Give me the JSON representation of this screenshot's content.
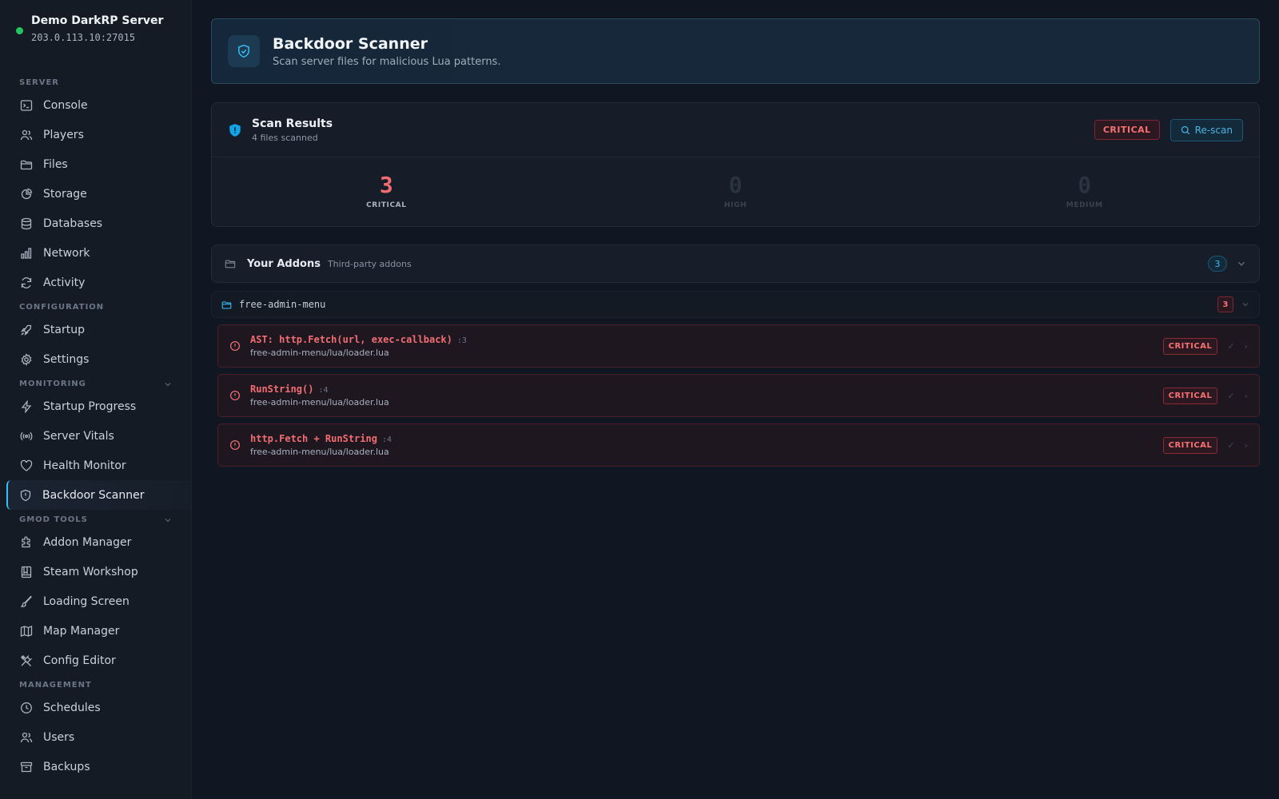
{
  "server": {
    "name": "Demo DarkRP Server",
    "address": "203.0.113.10:27015",
    "status_color": "#22c55e"
  },
  "sidebar": {
    "sections": {
      "server": "SERVER",
      "configuration": "CONFIGURATION",
      "monitoring": "MONITORING",
      "gmod_tools": "GMOD TOOLS",
      "management": "MANAGEMENT"
    },
    "items": {
      "console": "Console",
      "players": "Players",
      "files": "Files",
      "storage": "Storage",
      "databases": "Databases",
      "network": "Network",
      "activity": "Activity",
      "startup": "Startup",
      "settings": "Settings",
      "startup_progress": "Startup Progress",
      "server_vitals": "Server Vitals",
      "health_monitor": "Health Monitor",
      "backdoor_scanner": "Backdoor Scanner",
      "addon_manager": "Addon Manager",
      "steam_workshop": "Steam Workshop",
      "loading_screen": "Loading Screen",
      "map_manager": "Map Manager",
      "config_editor": "Config Editor",
      "schedules": "Schedules",
      "users": "Users",
      "backups": "Backups"
    },
    "active": "Backdoor Scanner"
  },
  "page": {
    "title": "Backdoor Scanner",
    "subtitle": "Scan server files for malicious Lua patterns."
  },
  "results": {
    "title": "Scan Results",
    "subtitle": "4 files scanned",
    "severity_badge": "CRITICAL",
    "rescan_label": "Re-scan",
    "stats": {
      "critical": {
        "value": "3",
        "label": "CRITICAL"
      },
      "high": {
        "value": "0",
        "label": "HIGH"
      },
      "medium": {
        "value": "0",
        "label": "MEDIUM"
      }
    }
  },
  "addons": {
    "title": "Your Addons",
    "subtitle": "Third-party addons",
    "count": "3",
    "folder": {
      "name": "free-admin-menu",
      "count": "3"
    },
    "findings": [
      {
        "title": "AST: http.Fetch(url, exec-callback)",
        "line": ":3",
        "path": "free-admin-menu/lua/loader.lua",
        "severity": "CRITICAL"
      },
      {
        "title": "RunString()",
        "line": ":4",
        "path": "free-admin-menu/lua/loader.lua",
        "severity": "CRITICAL"
      },
      {
        "title": "http.Fetch + RunString",
        "line": ":4",
        "path": "free-admin-menu/lua/loader.lua",
        "severity": "CRITICAL"
      }
    ]
  },
  "colors": {
    "accent": "#38bdf8",
    "critical": "#f87171",
    "background": "#111722"
  }
}
